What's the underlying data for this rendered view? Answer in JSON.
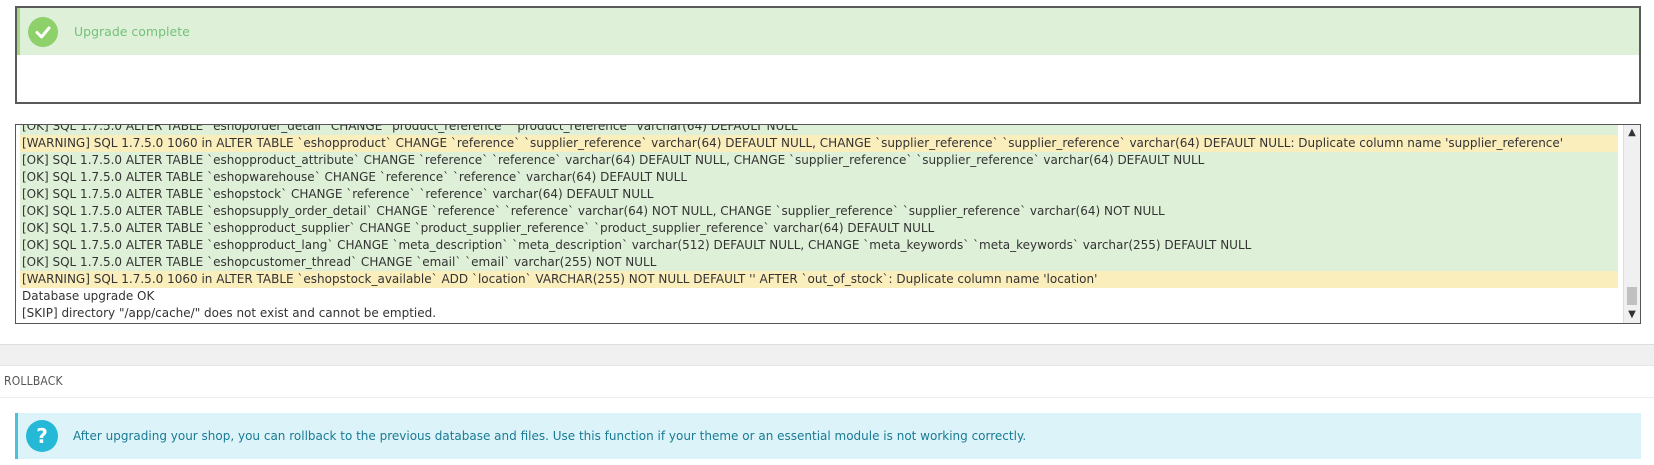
{
  "status": {
    "message": "Upgrade complete"
  },
  "log": {
    "lines": [
      {
        "type": "ok",
        "text": "[OK] SQL 1.7.5.0 ALTER TABLE `eshoporder_detail` CHANGE `product_reference` `product_reference` varchar(64) DEFAULT NULL"
      },
      {
        "type": "warning",
        "text": "[WARNING] SQL 1.7.5.0 1060 in ALTER TABLE `eshopproduct` CHANGE `reference` `supplier_reference` varchar(64) DEFAULT NULL, CHANGE `supplier_reference` `supplier_reference` varchar(64) DEFAULT NULL: Duplicate column name 'supplier_reference'"
      },
      {
        "type": "ok",
        "text": "[OK] SQL 1.7.5.0 ALTER TABLE `eshopproduct_attribute` CHANGE `reference` `reference` varchar(64) DEFAULT NULL, CHANGE `supplier_reference` `supplier_reference` varchar(64) DEFAULT NULL"
      },
      {
        "type": "ok",
        "text": "[OK] SQL 1.7.5.0 ALTER TABLE `eshopwarehouse` CHANGE `reference` `reference` varchar(64) DEFAULT NULL"
      },
      {
        "type": "ok",
        "text": "[OK] SQL 1.7.5.0 ALTER TABLE `eshopstock` CHANGE `reference` `reference` varchar(64) DEFAULT NULL"
      },
      {
        "type": "ok",
        "text": "[OK] SQL 1.7.5.0 ALTER TABLE `eshopsupply_order_detail` CHANGE `reference` `reference` varchar(64) NOT NULL, CHANGE `supplier_reference` `supplier_reference` varchar(64) NOT NULL"
      },
      {
        "type": "ok",
        "text": "[OK] SQL 1.7.5.0 ALTER TABLE `eshopproduct_supplier` CHANGE `product_supplier_reference` `product_supplier_reference` varchar(64) DEFAULT NULL"
      },
      {
        "type": "ok",
        "text": "[OK] SQL 1.7.5.0 ALTER TABLE `eshopproduct_lang` CHANGE `meta_description` `meta_description` varchar(512) DEFAULT NULL, CHANGE `meta_keywords` `meta_keywords` varchar(255) DEFAULT NULL"
      },
      {
        "type": "ok",
        "text": "[OK] SQL 1.7.5.0 ALTER TABLE `eshopcustomer_thread` CHANGE `email` `email` varchar(255) NOT NULL"
      },
      {
        "type": "warning",
        "text": "[WARNING] SQL 1.7.5.0 1060 in ALTER TABLE `eshopstock_available` ADD `location` VARCHAR(255) NOT NULL DEFAULT '' AFTER `out_of_stock`: Duplicate column name 'location'"
      },
      {
        "type": "plain",
        "text": "Database upgrade OK"
      },
      {
        "type": "plain",
        "text": "[SKIP] directory \"/app/cache/\" does not exist and cannot be emptied."
      }
    ]
  },
  "rollback": {
    "title": "ROLLBACK",
    "info": "After upgrading your shop, you can rollback to the previous database and files. Use this function if your theme or an essential module is not working correctly."
  },
  "icons": {
    "success": "check-circle-icon",
    "info": "question-circle-icon"
  },
  "colors": {
    "success_bg": "#dff0d8",
    "warning_bg": "#fbeebd",
    "info_bg": "#dcf4f9",
    "info_accent": "#25b9d7"
  }
}
